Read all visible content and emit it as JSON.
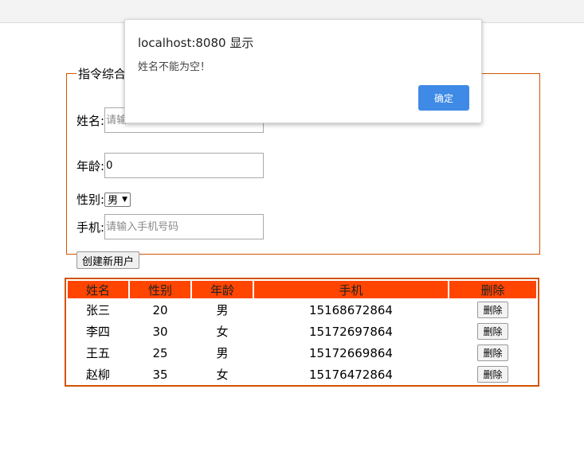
{
  "form": {
    "legend": "指令综合",
    "name_label": "姓名:",
    "name_placeholder": "请输",
    "age_label": "年龄:",
    "age_value": "0",
    "gender_label": "性别:",
    "gender_selected": "男",
    "phone_label": "手机:",
    "phone_placeholder": "请输入手机号码",
    "create_button": "创建新用户"
  },
  "table": {
    "headers": [
      "姓名",
      "性别",
      "年龄",
      "手机",
      "删除"
    ],
    "rows": [
      {
        "name": "张三",
        "col2": "20",
        "col3": "男",
        "phone": "15168672864",
        "delete": "删除"
      },
      {
        "name": "李四",
        "col2": "30",
        "col3": "女",
        "phone": "15172697864",
        "delete": "删除"
      },
      {
        "name": "王五",
        "col2": "25",
        "col3": "男",
        "phone": "15172669864",
        "delete": "删除"
      },
      {
        "name": "赵柳",
        "col2": "35",
        "col3": "女",
        "phone": "15176472864",
        "delete": "删除"
      }
    ]
  },
  "dialog": {
    "title": "localhost:8080 显示",
    "message": "姓名不能为空！",
    "ok_label": "确定"
  },
  "colors": {
    "accent": "#d35400",
    "header_bg": "#ff4500",
    "dialog_button": "#3e8ae6"
  }
}
